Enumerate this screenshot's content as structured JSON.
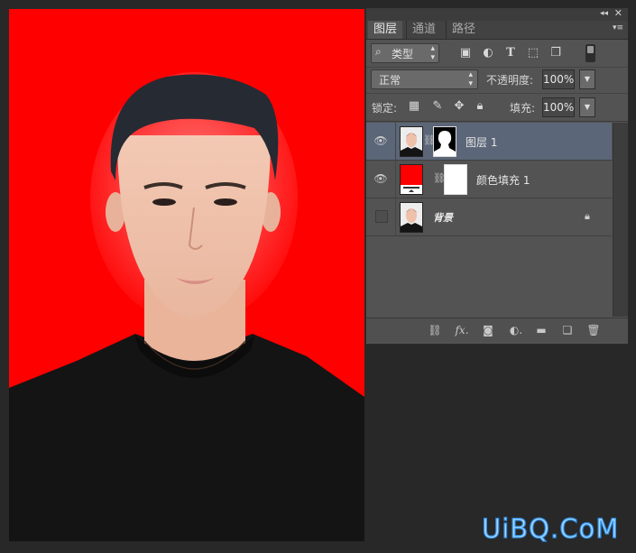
{
  "panel": {
    "collapse_icon": "collapse-icon",
    "close_icon": "close-icon",
    "tabs": [
      {
        "label": "图层",
        "active": true
      },
      {
        "label": "通道",
        "active": false
      },
      {
        "label": "路径",
        "active": false
      }
    ],
    "filter": {
      "kind_label": "类型"
    },
    "blend_mode": "正常",
    "opacity_label": "不透明度:",
    "opacity_value": "100%",
    "lock_label": "锁定:",
    "fill_label": "填充:",
    "fill_value": "100%"
  },
  "layers": [
    {
      "name": "图层 1",
      "visible": true,
      "selected": true,
      "has_mask": true
    },
    {
      "name": "颜色填充 1",
      "visible": true,
      "selected": false,
      "fill_color": "#ff0000"
    },
    {
      "name": "背景",
      "visible": false,
      "selected": false,
      "locked": true
    }
  ],
  "footer_icons": [
    "link-icon",
    "fx-icon",
    "mask-icon",
    "adjustment-icon",
    "folder-icon",
    "new-layer-icon",
    "trash-icon"
  ],
  "canvas": {
    "background_color": "#ff0000",
    "shirt_color": "#141414"
  },
  "watermark": "UiBQ.CoM",
  "colors": {
    "panel_bg": "#535353",
    "selected_layer": "#5b6678",
    "workspace_bg": "#282828"
  }
}
